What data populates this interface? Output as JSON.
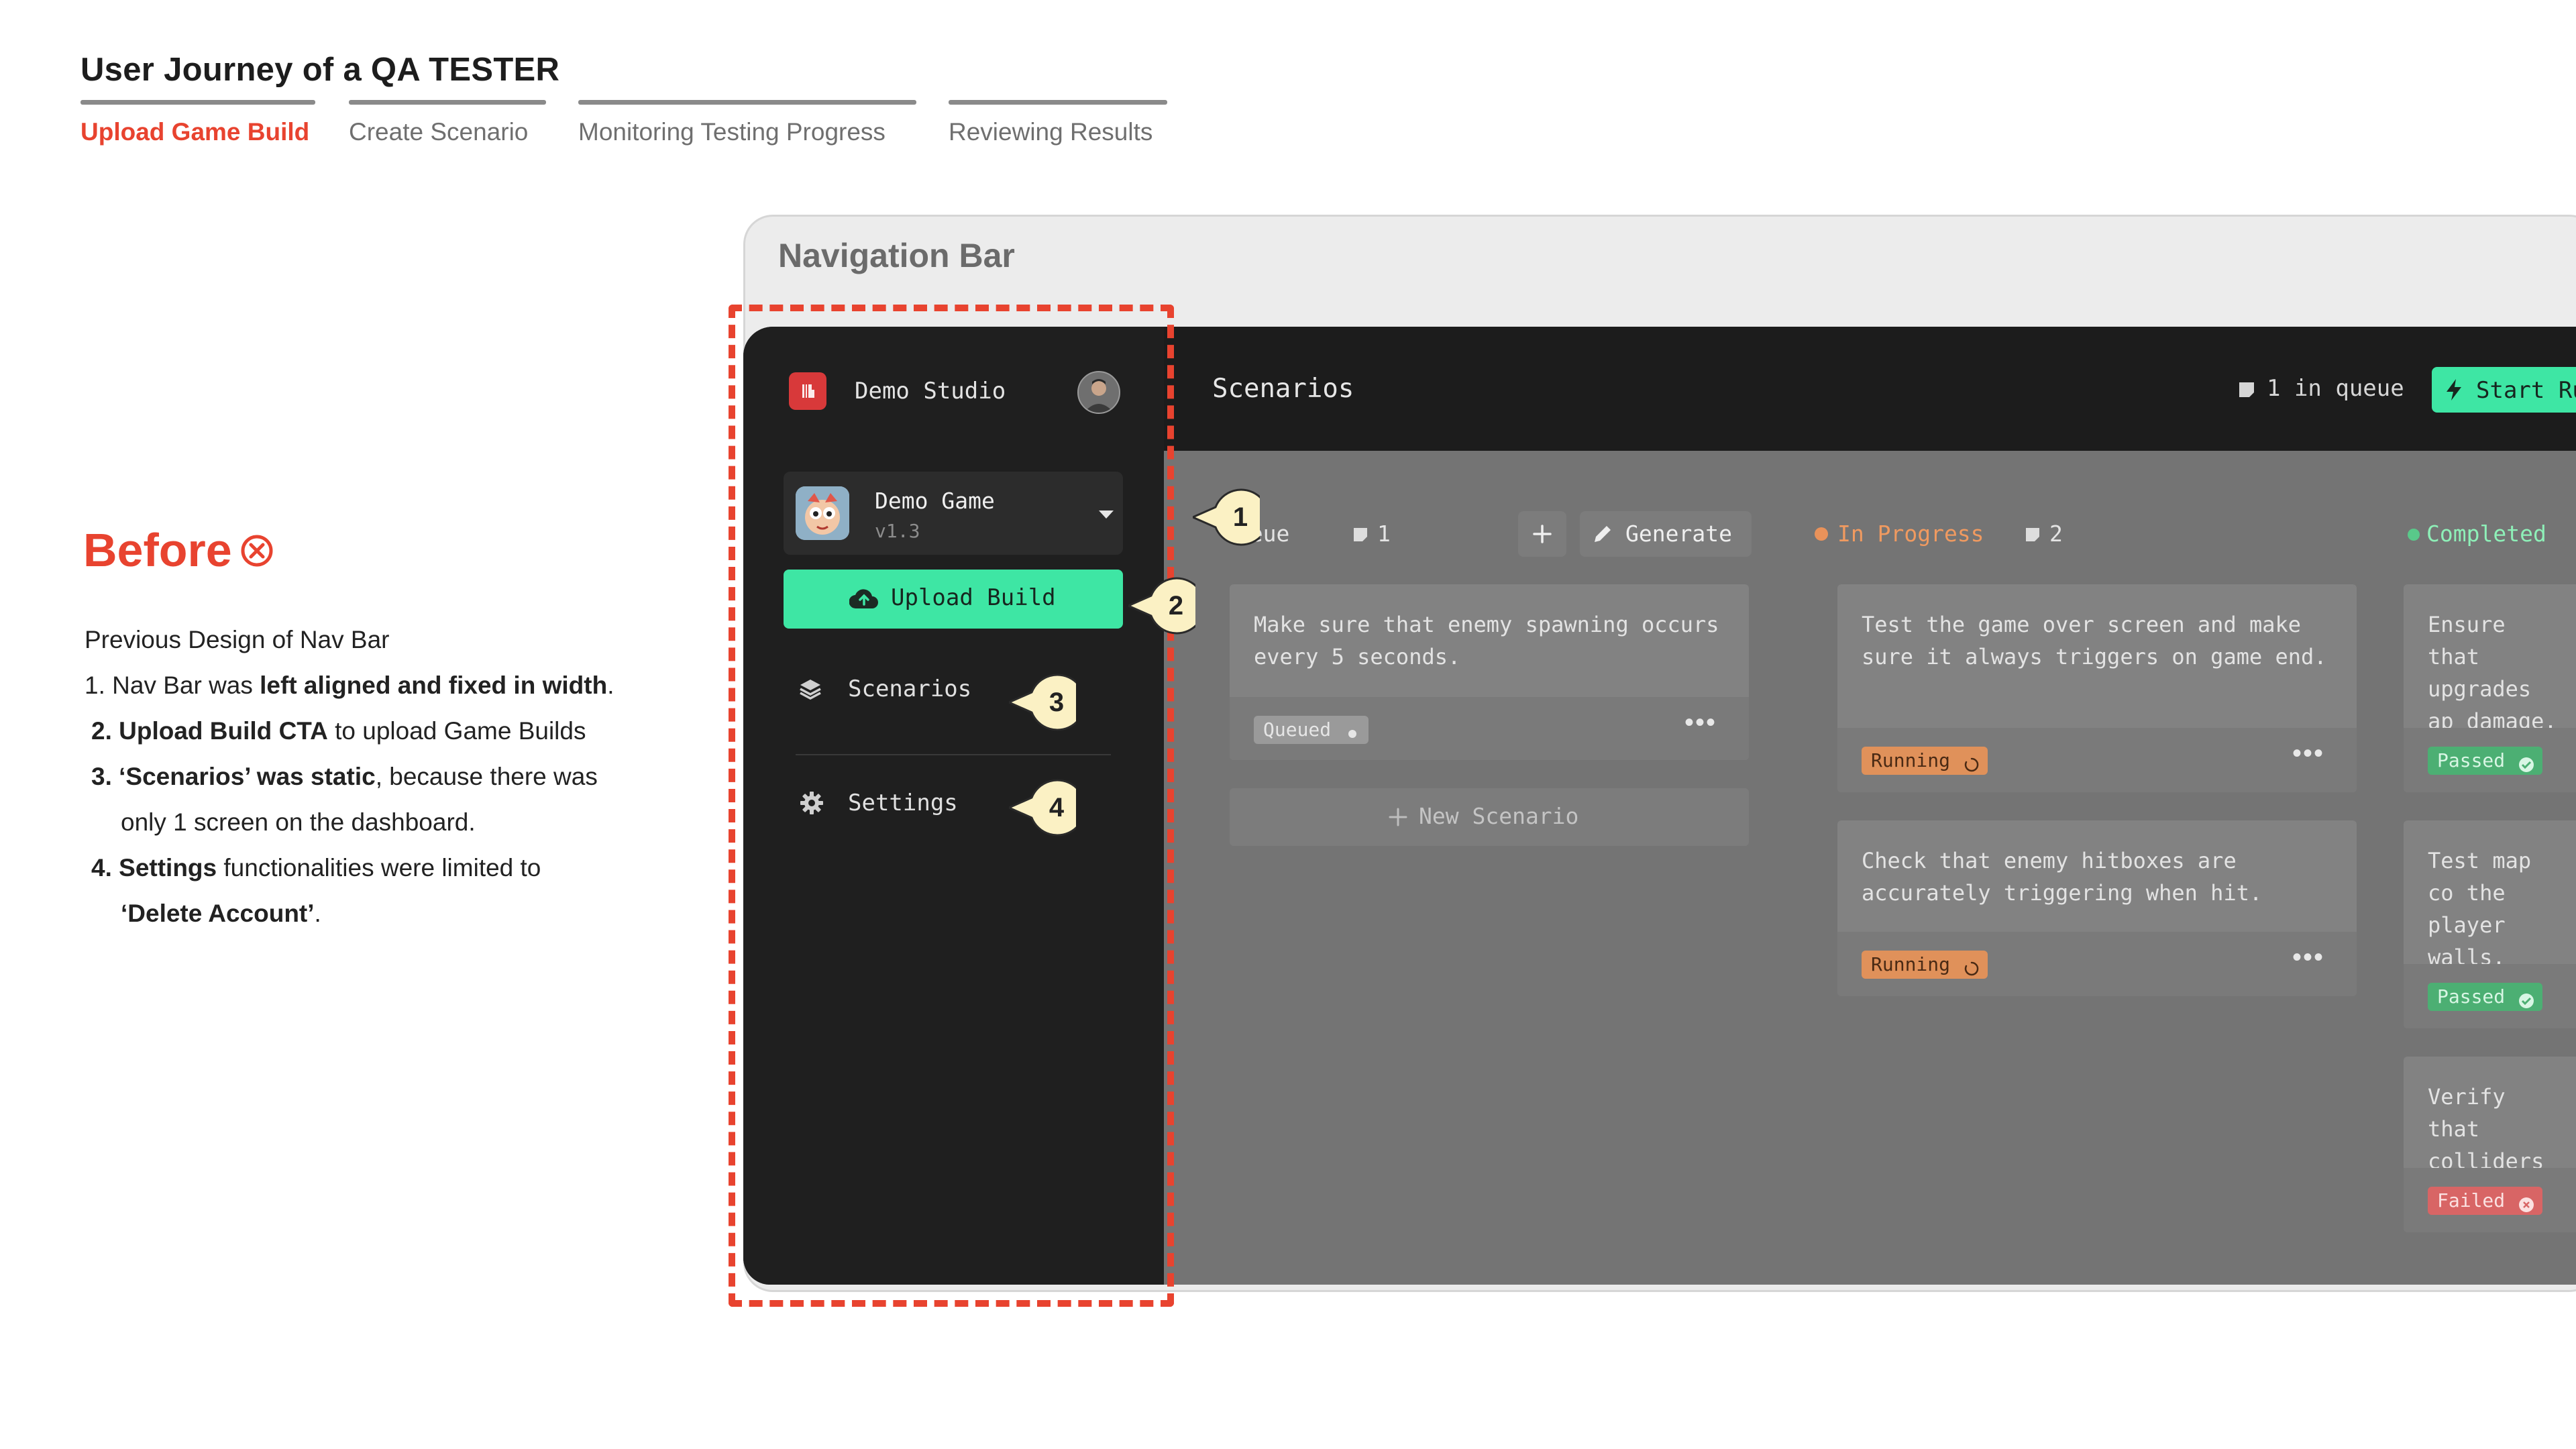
{
  "header": {
    "title": "User Journey of a QA TESTER",
    "steps": [
      "Upload Game Build",
      "Create Scenario",
      "Monitoring Testing Progress",
      "Reviewing Results"
    ]
  },
  "before": {
    "title": "Before",
    "intro": "Previous Design of Nav Bar",
    "points": [
      {
        "num": "1.",
        "bold": "left aligned and fixed in width",
        "pre": "Nav Bar was ",
        "post": "."
      },
      {
        "num": "2.",
        "bold": "Upload Build CTA",
        "pre": "",
        "post": " to upload Game Builds"
      },
      {
        "num": "3.",
        "bold": "‘Scenarios’ was static",
        "pre": "",
        "post": ", because there was",
        "cont": "only 1 screen on the dashboard."
      },
      {
        "num": "4.",
        "bold": "Settings",
        "pre": "",
        "post": " functionalities were limited to",
        "cont_bold": "‘Delete Account’",
        "cont_post": "."
      }
    ]
  },
  "mockup": {
    "frame_label": "Navigation Bar",
    "sidebar": {
      "studio": "Demo Studio",
      "game_name": "Demo Game",
      "game_version": "v1.3",
      "upload_label": "Upload Build",
      "nav": [
        "Scenarios",
        "Settings"
      ]
    },
    "topbar": {
      "title": "Scenarios",
      "queue_text": "1 in queue",
      "start_run": "Start Run"
    },
    "columns": [
      {
        "name": "Queue",
        "count": "1",
        "generate": "Generate",
        "new_scenario": "New Scenario",
        "cards": [
          {
            "text": "Make sure that enemy spawning occurs every 5 seconds.",
            "status": "Queued"
          }
        ]
      },
      {
        "name": "In Progress",
        "count": "2",
        "cards": [
          {
            "text": "Test the game over screen and make sure it always triggers on game end.",
            "status": "Running"
          },
          {
            "text": "Check that enemy hitboxes are accurately triggering when hit.",
            "status": "Running"
          }
        ]
      },
      {
        "name": "Completed",
        "cards": [
          {
            "text": "Ensure that upgrades ap damage.",
            "status": "Passed"
          },
          {
            "text": "Test map co the player walls.",
            "status": "Passed"
          },
          {
            "text": "Verify that colliders a",
            "status": "Failed"
          }
        ]
      }
    ],
    "callouts": [
      "1",
      "2",
      "3",
      "4"
    ],
    "colors": {
      "accent": "#e8432f",
      "cta": "#3ee6a4",
      "running": "#e0915a",
      "passed": "#4caf73",
      "failed": "#d86565"
    }
  }
}
